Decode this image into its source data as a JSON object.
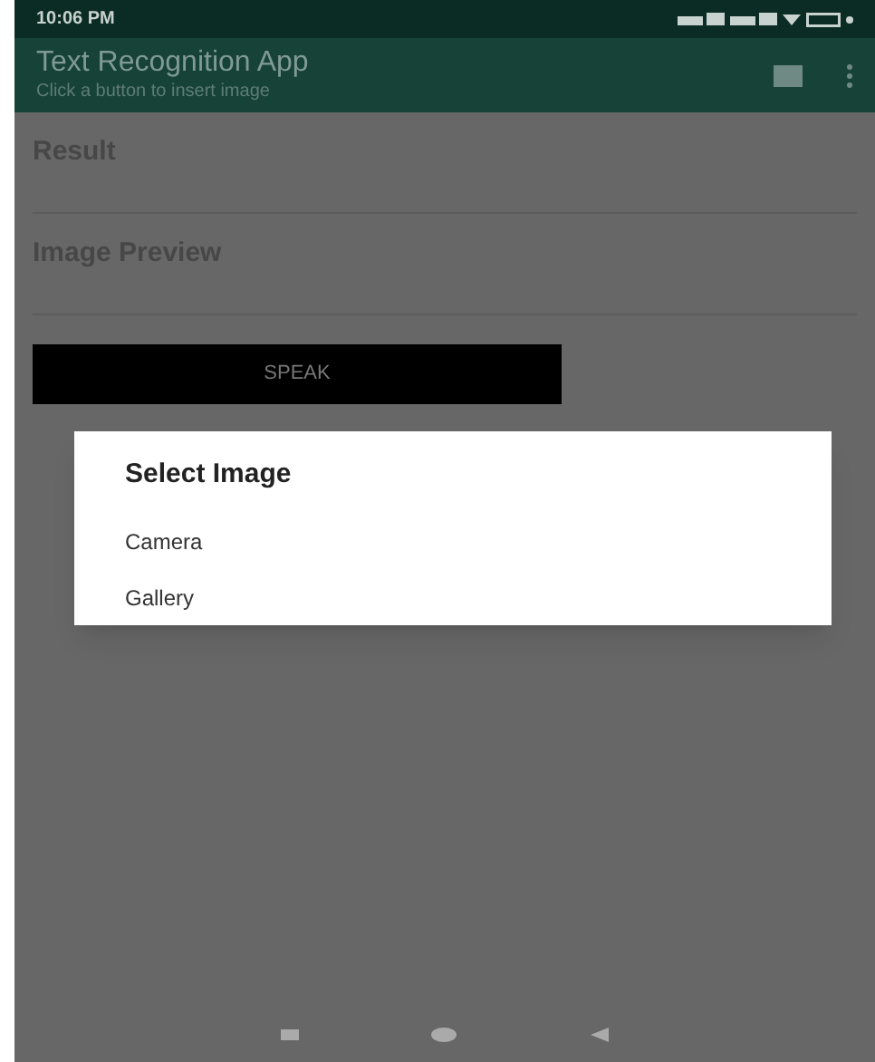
{
  "status_bar": {
    "time": "10:06 PM"
  },
  "toolbar": {
    "title": "Text Recognition App",
    "subtitle": "Click a button to insert image"
  },
  "fields": [
    {
      "label": "Result"
    },
    {
      "label": "Image Preview"
    }
  ],
  "speak_button": {
    "label": "SPEAK"
  },
  "dialog": {
    "title": "Select Image",
    "options": [
      {
        "label": "Camera"
      },
      {
        "label": "Gallery"
      }
    ]
  }
}
